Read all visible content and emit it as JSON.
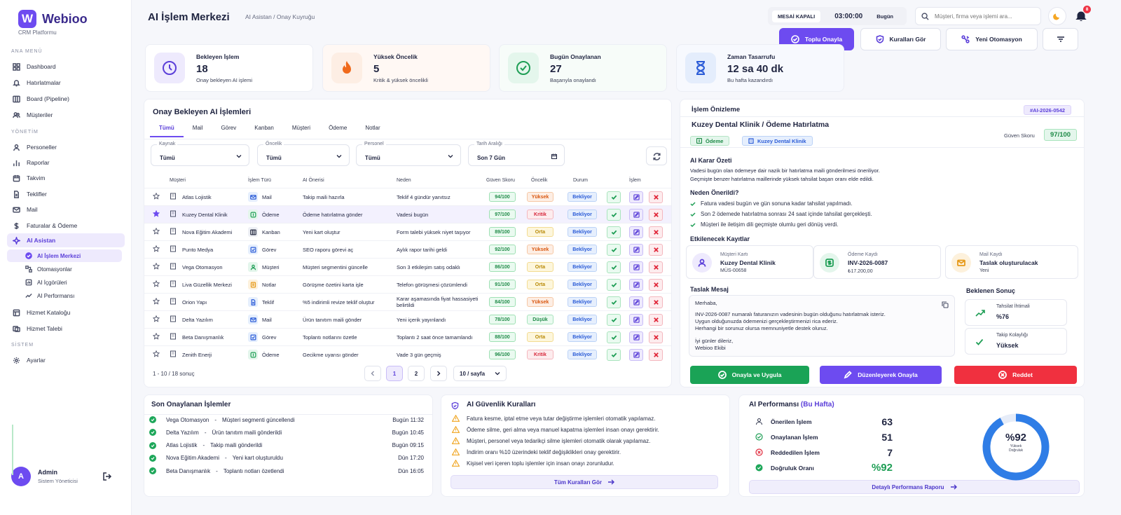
{
  "brand": {
    "logo": "W",
    "name": "Webioo",
    "subtitle": "CRM Platformu"
  },
  "sidebar": {
    "sections": {
      "main": "ANA MENÜ",
      "manage": "YÖNETİM",
      "system": "SİSTEM"
    },
    "items": [
      {
        "label": "Dashboard",
        "icon": "grid-icon"
      },
      {
        "label": "Hatırlatmalar",
        "icon": "bell-icon"
      },
      {
        "label": "Board (Pipeline)",
        "icon": "board-icon"
      },
      {
        "label": "Müşteriler",
        "icon": "users-icon"
      },
      {
        "label": "Personeller",
        "icon": "user-icon"
      },
      {
        "label": "Raporlar",
        "icon": "chart-icon"
      },
      {
        "label": "Takvim",
        "icon": "calendar-icon"
      },
      {
        "label": "Teklifler",
        "icon": "doc-icon"
      },
      {
        "label": "Mail",
        "icon": "mail-icon"
      },
      {
        "label": "Faturalar & Ödeme",
        "icon": "money-icon"
      },
      {
        "label": "AI Asistan",
        "icon": "sparkle-icon"
      },
      {
        "label": "Hizmet Kataloğu",
        "icon": "book-icon"
      },
      {
        "label": "Hizmet Talebi",
        "icon": "ticket-icon"
      },
      {
        "label": "Ayarlar",
        "icon": "gear-icon"
      }
    ],
    "sub": [
      "AI İşlem Merkezi",
      "Otomasyonlar",
      "AI İçgörüleri",
      "AI Performansı"
    ],
    "user": {
      "initial": "A",
      "name": "Admin",
      "role": "Sistem Yöneticisi"
    }
  },
  "header": {
    "title": "AI İşlem Merkezi",
    "breadcrumb": "AI Asistan  /  Onay Kuyruğu",
    "shift_status": "MESAİ KAPALI",
    "shift_timer": "03:00:00",
    "shift_day": "Bugün",
    "search_placeholder": "Müşteri, firma veya işlemi ara...",
    "notif_count": "8"
  },
  "toolbar": {
    "approve_all": "Toplu Onayla",
    "rules": "Kuralları Gör",
    "new_automation": "Yeni Otomasyon"
  },
  "stats": [
    {
      "title": "Bekleyen İşlem",
      "value": "18",
      "sub": "Onay bekleyen AI işlemi",
      "icon": "clock-icon",
      "color": "#5b3fd9",
      "bg": "#eeeafd"
    },
    {
      "title": "Yüksek Öncelik",
      "value": "5",
      "sub": "Kritik & yüksek öncelikli",
      "icon": "flame-icon",
      "color": "#f06a1c",
      "bg": "#fdeee4"
    },
    {
      "title": "Bugün Onaylanan",
      "value": "27",
      "sub": "Başarıyla onaylandı",
      "icon": "check-circle-icon",
      "color": "#1e9e55",
      "bg": "#e4f6ec"
    },
    {
      "title": "Zaman Tasarrufu",
      "value": "12 sa 40 dk",
      "sub": "Bu hafta kazandırdı",
      "icon": "hourglass-icon",
      "color": "#2a5bd7",
      "bg": "#e4edfc"
    }
  ],
  "queue": {
    "title": "Onay Bekleyen AI İşlemleri",
    "tabs": [
      "Tümü",
      "Mail",
      "Görev",
      "Kanban",
      "Müşteri",
      "Ödeme",
      "Notlar"
    ],
    "filters": [
      {
        "label": "Kaynak",
        "value": "Tümü"
      },
      {
        "label": "Öncelik",
        "value": "Tümü"
      },
      {
        "label": "Personel",
        "value": "Tümü"
      },
      {
        "label": "Tarih Aralığı",
        "value": "Son 7 Gün"
      }
    ],
    "columns": [
      "Müşteri",
      "İşlem Türü",
      "AI Önerisi",
      "Neden",
      "Güven Skoru",
      "Öncelik",
      "Durum",
      "İşlem"
    ],
    "rows": [
      {
        "customer": "Atlas Lojistik",
        "type": "Mail",
        "suggestion": "Takip maili hazırla",
        "reason": "Teklif 4 gündür yanıtsız",
        "score": "94/100",
        "priority": "Yüksek",
        "status": "Bekliyor",
        "starred": false
      },
      {
        "customer": "Kuzey Dental Klinik",
        "type": "Ödeme",
        "suggestion": "Ödeme hatırlatma gönder",
        "reason": "Vadesi bugün",
        "score": "97/100",
        "priority": "Kritik",
        "status": "Bekliyor",
        "starred": true
      },
      {
        "customer": "Nova Eğitim Akademi",
        "type": "Kanban",
        "suggestion": "Yeni kart oluştur",
        "reason": "Form talebi yüksek niyet taşıyor",
        "score": "89/100",
        "priority": "Orta",
        "status": "Bekliyor",
        "starred": false
      },
      {
        "customer": "Punto Medya",
        "type": "Görev",
        "suggestion": "SEO raporu görevi aç",
        "reason": "Aylık rapor tarihi geldi",
        "score": "92/100",
        "priority": "Yüksek",
        "status": "Bekliyor",
        "starred": false
      },
      {
        "customer": "Vega Otomasyon",
        "type": "Müşteri",
        "suggestion": "Müşteri segmentini güncelle",
        "reason": "Son 3 etkileşim satış odaklı",
        "score": "86/100",
        "priority": "Orta",
        "status": "Bekliyor",
        "starred": false
      },
      {
        "customer": "Liva Güzellik Merkezi",
        "type": "Notlar",
        "suggestion": "Görüşme özetini karta işle",
        "reason": "Telefon görüşmesi çözümlendi",
        "score": "91/100",
        "priority": "Orta",
        "status": "Bekliyor",
        "starred": false
      },
      {
        "customer": "Orion Yapı",
        "type": "Teklif",
        "suggestion": "%5 indirimli revize teklif oluştur",
        "reason": "Karar aşamasında fiyat hassasiyeti belirtildi",
        "score": "84/100",
        "priority": "Yüksek",
        "status": "Bekliyor",
        "starred": false
      },
      {
        "customer": "Delta Yazılım",
        "type": "Mail",
        "suggestion": "Ürün tanıtım maili gönder",
        "reason": "Yeni içerik yayınlandı",
        "score": "78/100",
        "priority": "Düşük",
        "status": "Bekliyor",
        "starred": false
      },
      {
        "customer": "Beta Danışmanlık",
        "type": "Görev",
        "suggestion": "Toplantı notlarını özetle",
        "reason": "Toplantı 2 saat önce tamamlandı",
        "score": "88/100",
        "priority": "Orta",
        "status": "Bekliyor",
        "starred": false
      },
      {
        "customer": "Zenith Enerji",
        "type": "Ödeme",
        "suggestion": "Gecikme uyarısı gönder",
        "reason": "Vade 3 gün geçmiş",
        "score": "96/100",
        "priority": "Kritik",
        "status": "Bekliyor",
        "starred": false
      }
    ],
    "range": "1 - 10 / 18 sonuç",
    "pages": [
      "1",
      "2"
    ],
    "per_page": "10 / sayfa"
  },
  "preview": {
    "title": "İşlem Önizleme",
    "id": "#AI-2026-0542",
    "heading": "Kuzey Dental Klinik / Ödeme Hatırlatma",
    "tag1": "Ödeme",
    "tag2": "Kuzey Dental Klinik",
    "score_label": "Güven Skoru",
    "score": "97/100",
    "summary_title": "AI Karar Özeti",
    "summary_1": "Vadesi bugün olan ödemeye dair nazik bir hatırlatma maili gönderilmesi öneriliyor.",
    "summary_2": "Geçmişte benzer hatırlatma maillerinde yüksek tahsilat başarı oranı elde edildi.",
    "why_title": "Neden Önerildi?",
    "why": [
      "Fatura vadesi bugün ve gün sonuna kadar tahsilat yapılmadı.",
      "Son 2 ödemede hatırlatma sonrası 24 saat içinde tahsilat gerçekleşti.",
      "Müşteri ile iletişim dili geçmişte olumlu geri dönüş verdi."
    ],
    "records_title": "Etkilenecek Kayıtlar",
    "records": [
      {
        "l1": "Müşteri Kartı",
        "l2": "Kuzey Dental Klinik",
        "l3": "MÜS-00658"
      },
      {
        "l1": "Ödeme Kaydı",
        "l2": "INV-2026-0087",
        "l3": "₺17.200,00"
      },
      {
        "l1": "Mail Kaydı",
        "l2": "Taslak oluşturulacak",
        "l3": "Yeni"
      }
    ],
    "draft_title": "Taslak Mesaj",
    "draft": [
      "Merhaba,",
      "INV-2026-0087 numaralı faturanızın vadesinin bugün olduğunu hatırlatmak isteriz.",
      "Uygun olduğunuzda ödemenizi gerçekleştirmenizi rica ederiz.",
      "Herhangi bir sorunuz olursa memnuniyetle destek oluruz.",
      "İyi günler dileriz,",
      "Webioo Ekibi"
    ],
    "expected_title": "Beklenen Sonuç",
    "expected": [
      {
        "l": "Tahsilat İhtimali",
        "v": "%76"
      },
      {
        "l": "Takip Kolaylığı",
        "v": "Yüksek"
      }
    ],
    "btn_apply": "Onayla ve Uygula",
    "btn_edit": "Düzenleyerek Onayla",
    "btn_reject": "Reddet"
  },
  "recent": {
    "title": "Son Onaylanan İşlemler",
    "items": [
      {
        "c": "Vega Otomasyon",
        "a": "Müşteri segmenti güncellendi",
        "t": "Bugün 11:32"
      },
      {
        "c": "Delta Yazılım",
        "a": "Ürün tanıtım maili gönderildi",
        "t": "Bugün 10:45"
      },
      {
        "c": "Atlas Lojistik",
        "a": "Takip maili gönderildi",
        "t": "Bugün 09:15"
      },
      {
        "c": "Nova Eğitim Akademi",
        "a": "Yeni kart oluşturuldu",
        "t": "Dün 17:20"
      },
      {
        "c": "Beta Danışmanlık",
        "a": "Toplantı notları özetlendi",
        "t": "Dün 16:05"
      }
    ],
    "sep": "-"
  },
  "rules": {
    "title": "AI Güvenlik Kuralları",
    "items": [
      "Fatura kesme, iptal etme veya tutar değiştirme işlemleri otomatik yapılamaz.",
      "Ödeme silme, geri alma veya manuel kapatma işlemleri insan onayı gerektirir.",
      "Müşteri, personel veya tedarikçi silme işlemleri otomatik olarak yapılamaz.",
      "İndirim oranı %10 üzerindeki teklif değişiklikleri onay gerektirir.",
      "Kişisel veri içeren toplu işlemler için insan onayı zorunludur."
    ],
    "link": "Tüm Kuralları Gör"
  },
  "perf": {
    "title": "AI Performansı",
    "period": "(Bu Hafta)",
    "items": [
      {
        "l": "Önerilen İşlem",
        "v": "63"
      },
      {
        "l": "Onaylanan İşlem",
        "v": "51"
      },
      {
        "l": "Reddedilen İşlem",
        "v": "7"
      },
      {
        "l": "Doğruluk Oranı",
        "v": "%92"
      }
    ],
    "donut_value": "%92",
    "donut_label_1": "Yüksek",
    "donut_label_2": "Doğruluk",
    "accuracy": 0.92,
    "link": "Detaylı Performans Raporu"
  }
}
